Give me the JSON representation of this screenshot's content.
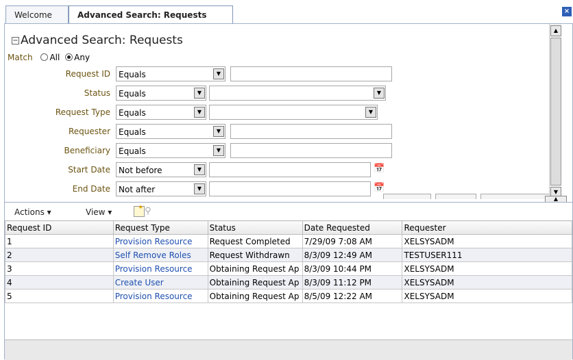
{
  "tabs": {
    "welcome": "Welcome",
    "active": "Advanced Search: Requests",
    "close_icon": "close-icon"
  },
  "panel": {
    "title": "Advanced Search: Requests",
    "match_label": "Match",
    "match_all": "All",
    "match_any": "Any",
    "match_selected": "Any"
  },
  "fields": [
    {
      "label": "Request ID",
      "operator": "Equals",
      "value_type": "text",
      "value": ""
    },
    {
      "label": "Status",
      "operator": "Equals",
      "value_type": "select",
      "value": ""
    },
    {
      "label": "Request Type",
      "operator": "Equals",
      "value_type": "select",
      "value": ""
    },
    {
      "label": "Requester",
      "operator": "Equals",
      "value_type": "text",
      "value": ""
    },
    {
      "label": "Beneficiary",
      "operator": "Equals",
      "value_type": "text",
      "value": ""
    },
    {
      "label": "Start Date",
      "operator": "Not before",
      "value_type": "date",
      "value": ""
    },
    {
      "label": "End Date",
      "operator": "Not after",
      "value_type": "date",
      "value": ""
    }
  ],
  "toolbar": {
    "actions_label": "Actions",
    "view_label": "View",
    "add_icon": "add-icon",
    "find_icon": "find-icon"
  },
  "table": {
    "columns": [
      "Request ID",
      "Request Type",
      "Status",
      "Date Requested",
      "Requester"
    ],
    "rows": [
      [
        "1",
        "Provision Resource",
        "Request Completed",
        "7/29/09 7:08 AM",
        "XELSYSADM"
      ],
      [
        "2",
        "Self Remove Roles",
        "Request Withdrawn",
        "8/3/09 12:49 AM",
        "TESTUSER111"
      ],
      [
        "3",
        "Provision Resource",
        "Obtaining Request Ap",
        "8/3/09 10:44 PM",
        "XELSYSADM"
      ],
      [
        "4",
        "Create User",
        "Obtaining Request Ap",
        "8/3/09 11:12 PM",
        "XELSYSADM"
      ],
      [
        "5",
        "Provision Resource",
        "Obtaining Request Ap",
        "8/5/09 12:22 AM",
        "XELSYSADM"
      ]
    ]
  },
  "colors": {
    "label": "#6b5310",
    "link": "#1f4fb0",
    "border": "#9fb0c8"
  }
}
